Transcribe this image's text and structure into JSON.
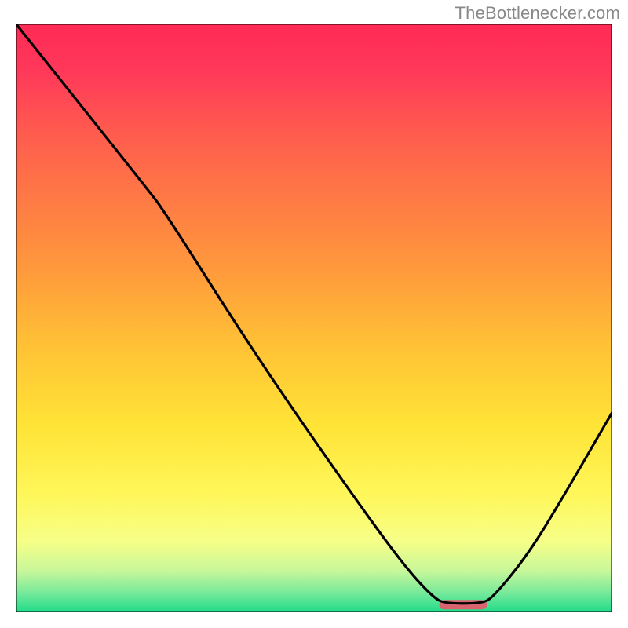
{
  "attribution": "TheBottlenecker.com",
  "chart_data": {
    "type": "line",
    "title": "",
    "xlabel": "",
    "ylabel": "",
    "xlim": [
      0,
      100
    ],
    "ylim": [
      0,
      100
    ],
    "categories_hidden": true,
    "series": [
      {
        "name": "curve",
        "color": "#000000",
        "points": [
          {
            "x": 0,
            "y": 100
          },
          {
            "x": 22,
            "y": 72
          },
          {
            "x": 25,
            "y": 68
          },
          {
            "x": 40,
            "y": 44
          },
          {
            "x": 55,
            "y": 22
          },
          {
            "x": 65,
            "y": 8
          },
          {
            "x": 70,
            "y": 2.5
          },
          {
            "x": 72,
            "y": 1.5
          },
          {
            "x": 78,
            "y": 1.5
          },
          {
            "x": 80,
            "y": 2.5
          },
          {
            "x": 86,
            "y": 10
          },
          {
            "x": 92,
            "y": 20
          },
          {
            "x": 100,
            "y": 34
          }
        ]
      }
    ],
    "optimum_marker": {
      "x_start": 71,
      "x_end": 79,
      "y": 1.3,
      "color": "#d9636e"
    },
    "background_gradient": {
      "stops": [
        {
          "offset": 0.0,
          "color": "#ff2a55"
        },
        {
          "offset": 0.08,
          "color": "#ff385a"
        },
        {
          "offset": 0.18,
          "color": "#ff5a4f"
        },
        {
          "offset": 0.3,
          "color": "#ff7a45"
        },
        {
          "offset": 0.42,
          "color": "#ff9a3c"
        },
        {
          "offset": 0.55,
          "color": "#ffc235"
        },
        {
          "offset": 0.68,
          "color": "#ffe336"
        },
        {
          "offset": 0.8,
          "color": "#fff75a"
        },
        {
          "offset": 0.88,
          "color": "#f6ff88"
        },
        {
          "offset": 0.93,
          "color": "#c8f79a"
        },
        {
          "offset": 0.97,
          "color": "#6fe89a"
        },
        {
          "offset": 1.0,
          "color": "#1fdc8a"
        }
      ]
    }
  }
}
